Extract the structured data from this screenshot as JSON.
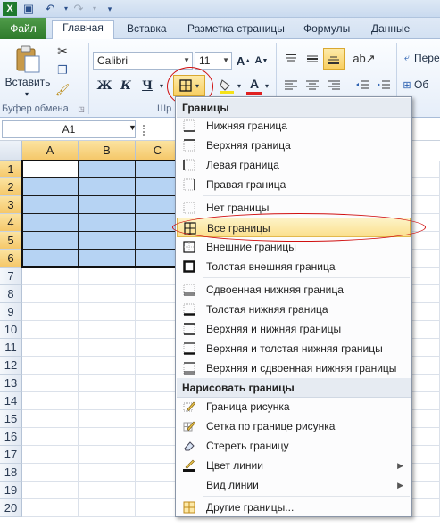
{
  "qat": {
    "icons": [
      "excel-icon",
      "save-icon",
      "undo-icon",
      "redo-icon",
      "customize-icon"
    ]
  },
  "tabs": {
    "file": "Файл",
    "home": "Главная",
    "insert": "Вставка",
    "page_layout": "Разметка страницы",
    "formulas": "Формулы",
    "data": "Данные"
  },
  "ribbon": {
    "paste_label": "Вставить",
    "clipboard_group": "Буфер обмена",
    "font_name": "Calibri",
    "font_size": "11",
    "bold": "Ж",
    "italic": "К",
    "underline": "Ч",
    "font_group_partial": "Шр",
    "wrap_label": "Пере",
    "merge_label": "Об"
  },
  "formula_bar": {
    "name_box": "A1"
  },
  "columns": [
    "A",
    "B",
    "C"
  ],
  "rows": [
    "1",
    "2",
    "3",
    "4",
    "5",
    "6",
    "7",
    "8",
    "9",
    "10",
    "11",
    "12",
    "13",
    "14",
    "15",
    "16",
    "17",
    "18",
    "19",
    "20"
  ],
  "menu": {
    "section1": "Границы",
    "items1": [
      "Нижняя граница",
      "Верхняя граница",
      "Левая граница",
      "Правая граница",
      "Нет границы",
      "Все границы",
      "Внешние границы",
      "Толстая внешняя граница",
      "Сдвоенная нижняя граница",
      "Толстая нижняя граница",
      "Верхняя и нижняя границы",
      "Верхняя и толстая нижняя границы",
      "Верхняя и сдвоенная нижняя границы"
    ],
    "highlighted": "Все границы",
    "section2": "Нарисовать границы",
    "items2": [
      "Граница рисунка",
      "Сетка по границе рисунка",
      "Стереть границу",
      "Цвет линии",
      "Вид линии",
      "Другие границы..."
    ]
  },
  "colors": {
    "selection": "#b6d3f3",
    "file_tab": "#3a8a35",
    "highlight": "#fbe08e",
    "annotation": "#d01010"
  }
}
